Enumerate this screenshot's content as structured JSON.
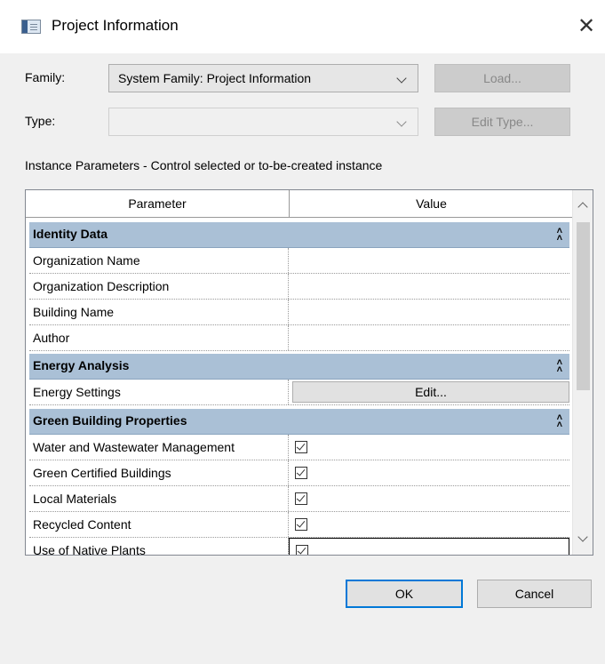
{
  "window": {
    "title": "Project Information"
  },
  "family": {
    "label": "Family:",
    "value": "System Family: Project Information",
    "load_label": "Load..."
  },
  "type": {
    "label": "Type:",
    "value": "",
    "edit_type_label": "Edit Type..."
  },
  "instance_label": "Instance Parameters - Control selected or to-be-created instance",
  "grid": {
    "headers": {
      "parameter": "Parameter",
      "value": "Value"
    },
    "groups": [
      {
        "title": "Identity Data",
        "collapse_icon": "double-chevron-up-icon",
        "rows": [
          "Organization Name",
          "Organization Description",
          "Building Name",
          "Author"
        ]
      },
      {
        "title": "Energy Analysis",
        "collapse_icon": "double-chevron-up-icon",
        "rows": [
          "Energy Settings"
        ],
        "edit_label": "Edit..."
      },
      {
        "title": "Green Building Properties",
        "collapse_icon": "double-chevron-up-icon",
        "rows": [
          "Water and Wastewater Management",
          "Green Certified Buildings",
          "Local Materials",
          "Recycled Content",
          "Use of Native Plants"
        ],
        "checked": [
          true,
          true,
          true,
          true,
          true
        ]
      }
    ]
  },
  "buttons": {
    "ok": "OK",
    "cancel": "Cancel"
  },
  "colors": {
    "group_header": "#aac0d6",
    "default_button_border": "#0078d7"
  }
}
